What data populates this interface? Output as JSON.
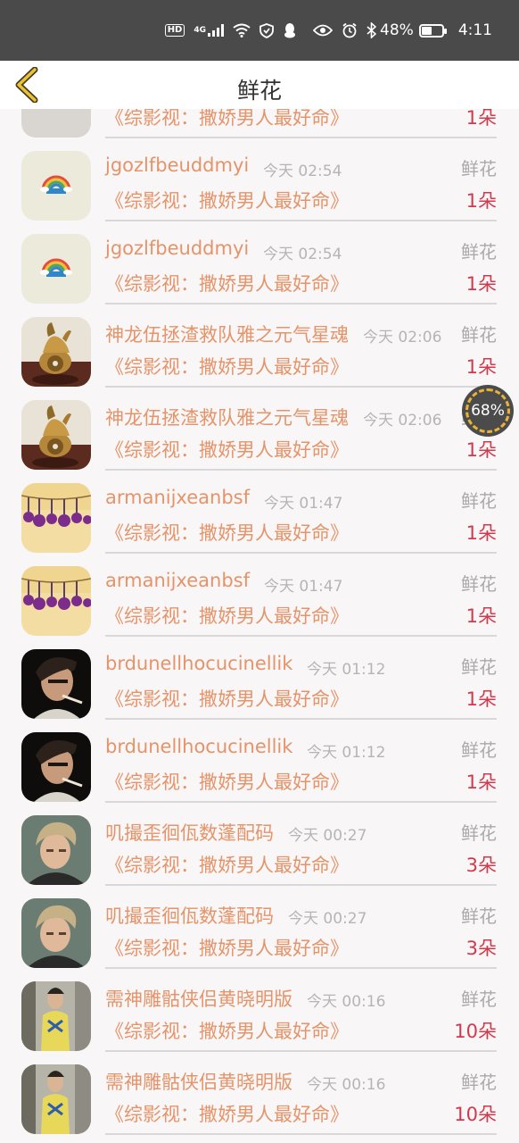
{
  "status_bar": {
    "hd": "HD",
    "network": "4G",
    "battery": "48%",
    "battery_level": 0.48,
    "time": "4:11"
  },
  "nav": {
    "title": "鲜花",
    "back_icon": "chevron-left-icon"
  },
  "float_badge": {
    "percent": "68%"
  },
  "rows": [
    {
      "name": "",
      "time": "",
      "type": "",
      "book": "《综影视：撒娇男人最好命》",
      "count": "1朵",
      "avatar": "partial"
    },
    {
      "name": "jgozlfbeuddmyi",
      "time": "今天 02:54",
      "type": "鲜花",
      "book": "《综影视：撒娇男人最好命》",
      "count": "1朵",
      "avatar": "rainbow"
    },
    {
      "name": "jgozlfbeuddmyi",
      "time": "今天 02:54",
      "type": "鲜花",
      "book": "《综影视：撒娇男人最好命》",
      "count": "1朵",
      "avatar": "rainbow"
    },
    {
      "name": "神龙伍拯渣救队雅之元气星魂",
      "time": "今天 02:06",
      "type": "鲜花",
      "book": "《综影视：撒娇男人最好命》",
      "count": "1朵",
      "avatar": "statue"
    },
    {
      "name": "神龙伍拯渣救队雅之元气星魂",
      "time": "今天 02:06",
      "type": "鲜花",
      "book": "《综影视：撒娇男人最好命》",
      "count": "1朵",
      "avatar": "statue"
    },
    {
      "name": "armanijxeanbsf",
      "time": "今天 01:47",
      "type": "鲜花",
      "book": "《综影视：撒娇男人最好命》",
      "count": "1朵",
      "avatar": "flowers"
    },
    {
      "name": "armanijxeanbsf",
      "time": "今天 01:47",
      "type": "鲜花",
      "book": "《综影视：撒娇男人最好命》",
      "count": "1朵",
      "avatar": "flowers"
    },
    {
      "name": "brdunellhocucinellik",
      "time": "今天 01:12",
      "type": "鲜花",
      "book": "《综影视：撒娇男人最好命》",
      "count": "1朵",
      "avatar": "portrait-dark"
    },
    {
      "name": "brdunellhocucinellik",
      "time": "今天 01:12",
      "type": "鲜花",
      "book": "《综影视：撒娇男人最好命》",
      "count": "1朵",
      "avatar": "portrait-dark"
    },
    {
      "name": "叽撮歪徊佤数蓬配码",
      "time": "今天 00:27",
      "type": "鲜花",
      "book": "《综影视：撒娇男人最好命》",
      "count": "3朵",
      "avatar": "portrait-blond"
    },
    {
      "name": "叽撮歪徊佤数蓬配码",
      "time": "今天 00:27",
      "type": "鲜花",
      "book": "《综影视：撒娇男人最好命》",
      "count": "3朵",
      "avatar": "portrait-blond"
    },
    {
      "name": "需神雕骷侠侣黄晓明版",
      "time": "今天 00:16",
      "type": "鲜花",
      "book": "《综影视：撒娇男人最好命》",
      "count": "10朵",
      "avatar": "portrait-street"
    },
    {
      "name": "需神雕骷侠侣黄晓明版",
      "time": "今天 00:16",
      "type": "鲜花",
      "book": "《综影视：撒娇男人最好命》",
      "count": "10朵",
      "avatar": "portrait-street"
    }
  ]
}
